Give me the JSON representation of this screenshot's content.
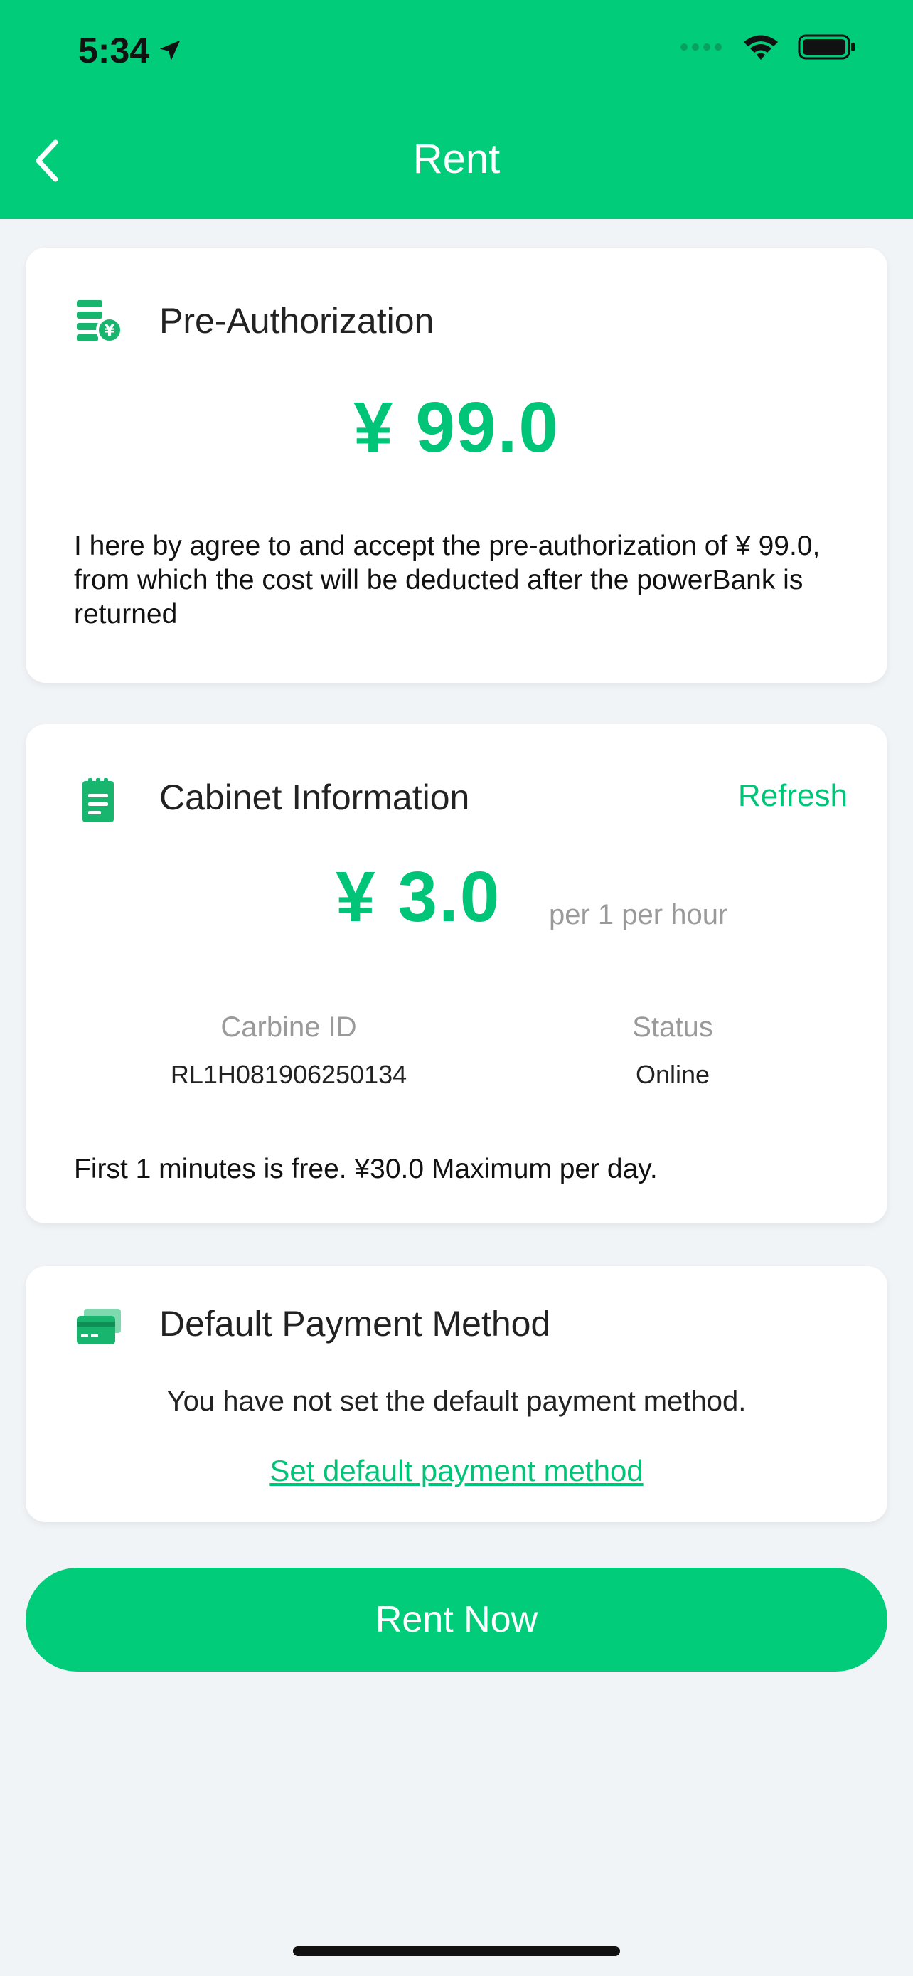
{
  "status_bar": {
    "time": "5:34"
  },
  "nav": {
    "title": "Rent"
  },
  "pre_auth": {
    "title": "Pre-Authorization",
    "amount": "¥ 99.0",
    "agreement": "I here by agree to and accept the pre-authorization of ¥ 99.0, from which the cost will be deducted after the powerBank is returned"
  },
  "cabinet": {
    "title": "Cabinet Information",
    "refresh_label": "Refresh",
    "price": "¥ 3.0",
    "unit": "per 1 per hour",
    "id_label": "Carbine ID",
    "id_value": "RL1H081906250134",
    "status_label": "Status",
    "status_value": "Online",
    "note": "First 1 minutes is free. ¥30.0 Maximum per day."
  },
  "payment": {
    "title": "Default Payment Method",
    "message": "You have not set the default payment method.",
    "link": "Set default payment method"
  },
  "action": {
    "rent_now": "Rent Now"
  },
  "colors": {
    "accent": "#00cc7a",
    "price": "#00c477",
    "background": "#f1f4f7"
  }
}
